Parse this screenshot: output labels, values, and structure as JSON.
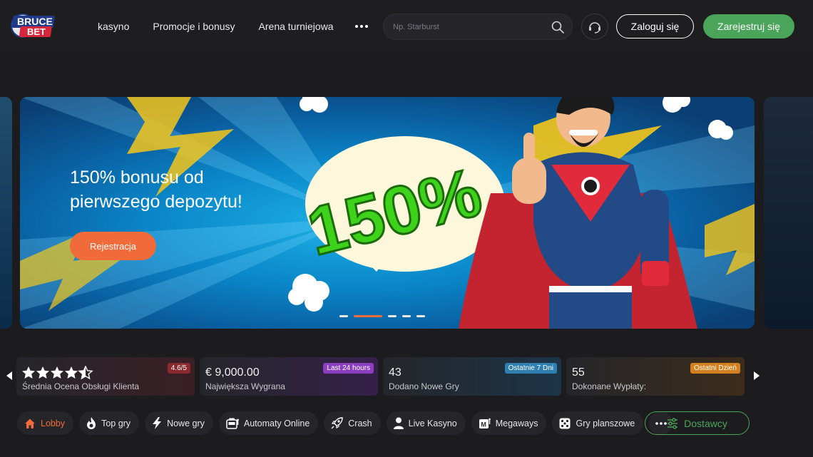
{
  "brand": {
    "logo_line1": "BRUCE",
    "logo_line2": "BET"
  },
  "nav": {
    "items": [
      "kasyno",
      "Promocje i bonusy",
      "Arena turniejowa"
    ]
  },
  "search": {
    "placeholder": "Np. Starburst"
  },
  "auth": {
    "login_label": "Zaloguj się",
    "register_label": "Zarejestruj się"
  },
  "hero": {
    "title": "150% bonusu od pierwszego depozytu!",
    "cta_label": "Rejestracja",
    "artwork_text": "150%",
    "dots_count": 6,
    "active_dot": 1
  },
  "stats": [
    {
      "value": "",
      "rating": 4.5,
      "label": "Średnia Ocena Obsługi Klienta",
      "badge": "4.6/5",
      "badge_color": "#8a2a2f"
    },
    {
      "value": "€ 9,000.00",
      "label": "Największa Wygrana",
      "badge": "Last 24 hours",
      "badge_color": "#8b3fc0"
    },
    {
      "value": "43",
      "label": "Dodano Nowe Gry",
      "badge": "Ostatnie 7 Dni",
      "badge_color": "#2f7fb0"
    },
    {
      "value": "55",
      "label": "Dokonane Wypłaty:",
      "badge": "Ostatni Dzień",
      "badge_color": "#d4801e"
    }
  ],
  "categories": [
    {
      "label": "Lobby",
      "icon": "home-icon",
      "active": true
    },
    {
      "label": "Top gry",
      "icon": "flame-icon"
    },
    {
      "label": "Nowe gry",
      "icon": "lightning-icon"
    },
    {
      "label": "Automaty Online",
      "icon": "slot-machine-icon"
    },
    {
      "label": "Crash",
      "icon": "rocket-icon"
    },
    {
      "label": "Live Kasyno",
      "icon": "person-icon"
    },
    {
      "label": "Megaways",
      "icon": "slot-m-icon"
    },
    {
      "label": "Gry planszowe",
      "icon": "dice-icon"
    }
  ],
  "providers": {
    "label": "Dostawcy"
  },
  "colors": {
    "accent": "#f06a3a",
    "green": "#4aa55a",
    "background": "#1c1c1e"
  }
}
